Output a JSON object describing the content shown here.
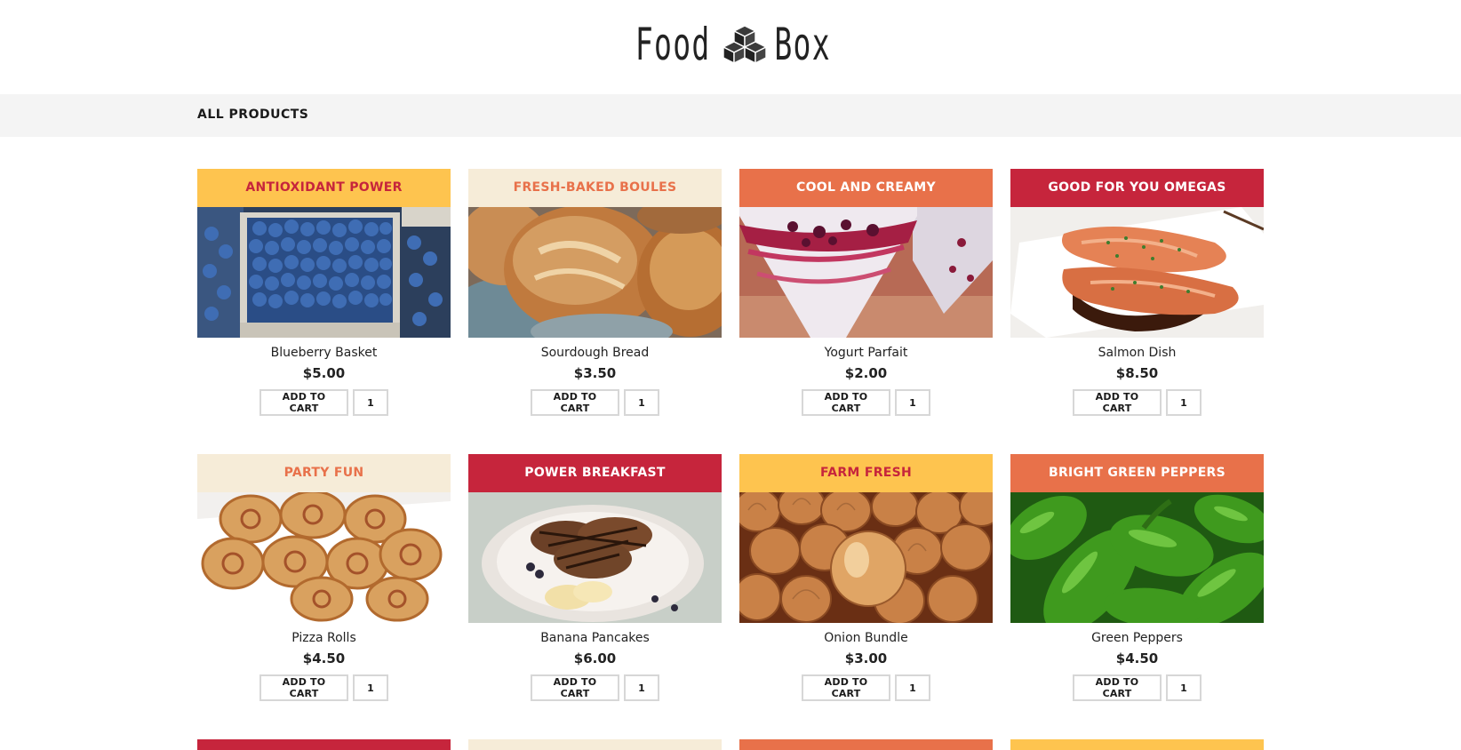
{
  "brand": {
    "word_left": "Food",
    "word_right": "Box",
    "logo_icon": "cubes-icon"
  },
  "nav": {
    "label": "ALL PRODUCTS"
  },
  "colors": {
    "yellow": "#fec44f",
    "cream": "#f6ecd8",
    "orange": "#e8714a",
    "red": "#c6253c",
    "btn_border": "#d7d7d7"
  },
  "products": [
    {
      "banner": "ANTIOXIDANT POWER",
      "banner_bg": "#fec44f",
      "banner_fg": "#c6253c",
      "name": "Blueberry Basket",
      "price": "$5.00",
      "cta": "ADD TO CART",
      "qty": "1",
      "image": "blueberries-image"
    },
    {
      "banner": "FRESH-BAKED BOULES",
      "banner_bg": "#f6ecd8",
      "banner_fg": "#e8714a",
      "name": "Sourdough Bread",
      "price": "$3.50",
      "cta": "ADD TO CART",
      "qty": "1",
      "image": "bread-image"
    },
    {
      "banner": "COOL AND CREAMY",
      "banner_bg": "#e8714a",
      "banner_fg": "#ffffff",
      "name": "Yogurt Parfait",
      "price": "$2.00",
      "cta": "ADD TO CART",
      "qty": "1",
      "image": "yogurt-image"
    },
    {
      "banner": "GOOD FOR YOU OMEGAS",
      "banner_bg": "#c6253c",
      "banner_fg": "#ffffff",
      "name": "Salmon Dish",
      "price": "$8.50",
      "cta": "ADD TO CART",
      "qty": "1",
      "image": "salmon-image"
    },
    {
      "banner": "PARTY FUN",
      "banner_bg": "#f6ecd8",
      "banner_fg": "#e8714a",
      "name": "Pizza Rolls",
      "price": "$4.50",
      "cta": "ADD TO CART",
      "qty": "1",
      "image": "pizza-rolls-image"
    },
    {
      "banner": "POWER BREAKFAST",
      "banner_bg": "#c6253c",
      "banner_fg": "#ffffff",
      "name": "Banana Pancakes",
      "price": "$6.00",
      "cta": "ADD TO CART",
      "qty": "1",
      "image": "pancakes-image"
    },
    {
      "banner": "FARM FRESH",
      "banner_bg": "#fec44f",
      "banner_fg": "#c6253c",
      "name": "Onion Bundle",
      "price": "$3.00",
      "cta": "ADD TO CART",
      "qty": "1",
      "image": "onions-image"
    },
    {
      "banner": "BRIGHT GREEN PEPPERS",
      "banner_bg": "#e8714a",
      "banner_fg": "#ffffff",
      "name": "Green Peppers",
      "price": "$4.50",
      "cta": "ADD TO CART",
      "qty": "1",
      "image": "peppers-image"
    }
  ],
  "next_row_banner_colors": [
    "#c6253c",
    "#f6ecd8",
    "#e8714a",
    "#fec44f"
  ]
}
